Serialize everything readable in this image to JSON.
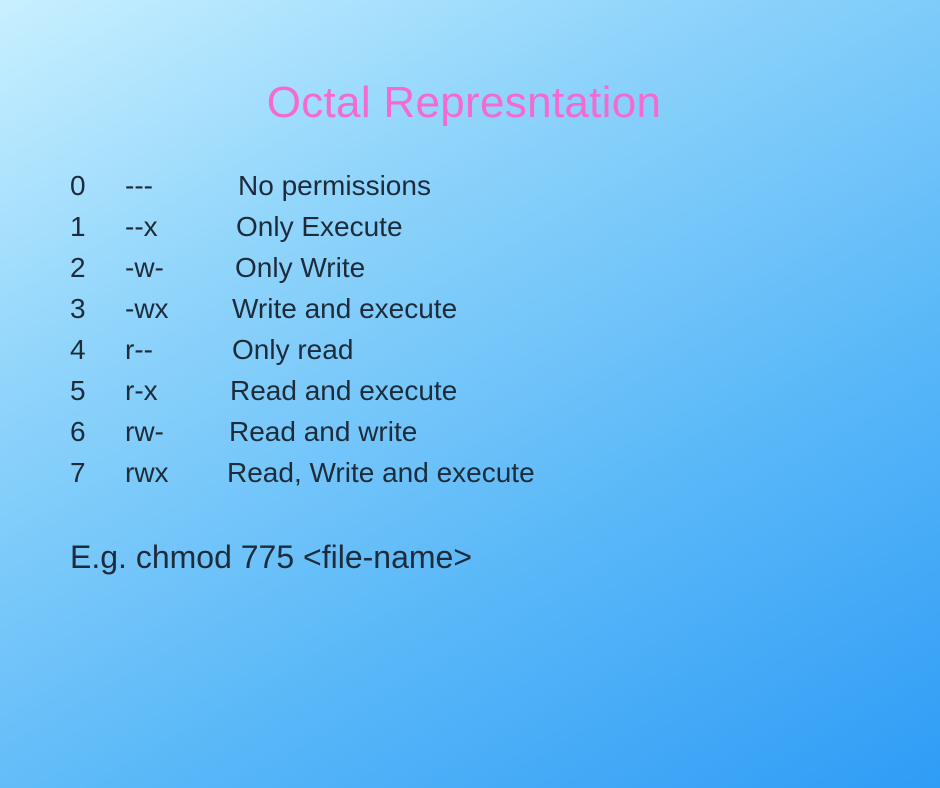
{
  "title": "Octal Represntation",
  "permissions": [
    {
      "octal": "0",
      "symbolic": "---",
      "description": "No permissions"
    },
    {
      "octal": "1",
      "symbolic": "--x",
      "description": "Only Execute"
    },
    {
      "octal": "2",
      "symbolic": "-w-",
      "description": "Only Write"
    },
    {
      "octal": "3",
      "symbolic": "-wx",
      "description": "Write and execute"
    },
    {
      "octal": "4",
      "symbolic": "r--",
      "description": "Only read"
    },
    {
      "octal": "5",
      "symbolic": "r-x",
      "description": "Read and execute"
    },
    {
      "octal": "6",
      "symbolic": "rw-",
      "description": "Read and write"
    },
    {
      "octal": "7",
      "symbolic": "rwx",
      "description": "Read, Write and execute"
    }
  ],
  "example": "E.g. chmod 775 <file-name>",
  "colors": {
    "title": "#f46ad0",
    "text": "#1d2b3a",
    "background_start": "#c8f0ff",
    "background_end": "#2f9cf6"
  }
}
